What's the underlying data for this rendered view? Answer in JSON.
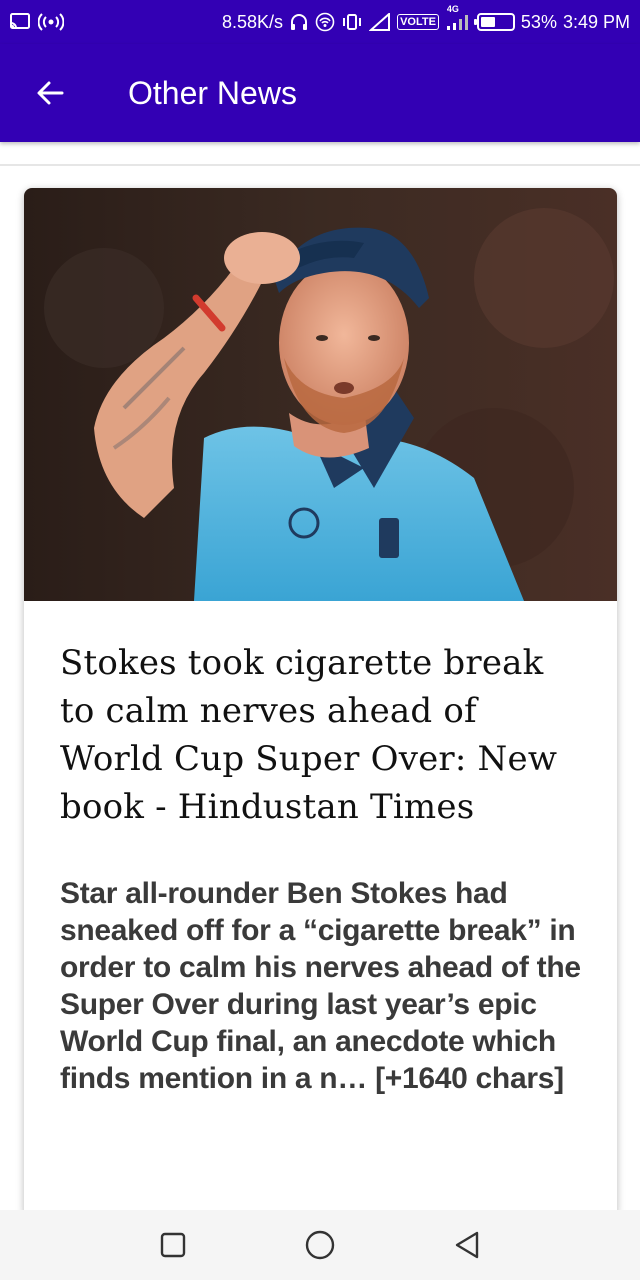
{
  "status_bar": {
    "net_speed": "8.58K/s",
    "volte": "VOLTE",
    "network_type": "4G",
    "battery_percent": "53%",
    "battery_level": 0.53,
    "time": "3:49 PM",
    "icons": [
      "cast-icon",
      "hotspot-icon",
      "headphones-icon",
      "wifi-icon",
      "vibrate-icon",
      "signal-icon",
      "battery-icon"
    ]
  },
  "app_bar": {
    "title": "Other News",
    "back_icon": "arrow-left-icon"
  },
  "article": {
    "image_alt": "Cricketer in light blue jersey adjusting his cap",
    "headline": "Stokes took cigarette break to calm nerves ahead of World Cup Super Over: New book - Hindustan Times",
    "summary": "Star all-rounder Ben Stokes had sneaked off for a “cigarette break” in order to calm his nerves ahead of the Super Over during last year’s epic World Cup final, an anecdote which finds mention in a n… [+1640 chars]"
  },
  "nav_bar": {
    "buttons": [
      "recents-icon",
      "home-icon",
      "back-icon"
    ]
  },
  "colors": {
    "primary": "#3300b4",
    "card_bg": "#ffffff",
    "headline": "#111111",
    "summary": "#3a3a3a"
  }
}
